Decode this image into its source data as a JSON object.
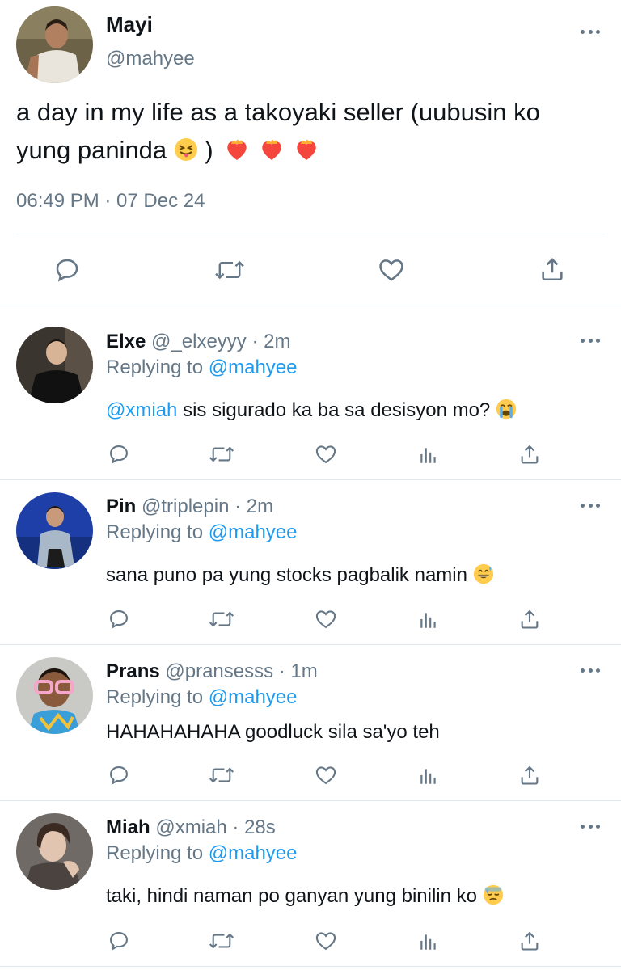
{
  "tweet": {
    "name": "Mayi",
    "handle": "@mahyee",
    "text_line1": "a day in my life as a takoyaki seller (uubusin ko",
    "text_line2_pre": "yung paninda",
    "text_line2_post": ")",
    "timestamp": "06:49 PM · 07 Dec 24"
  },
  "replies": [
    {
      "name": "Elxe",
      "handle": "@_elxeyyy",
      "time": "· 2m",
      "replying_label": "Replying to",
      "replying_to": "@mahyee",
      "mention": "@xmiah",
      "text": "sis sigurado ka ba sa desisyon mo?"
    },
    {
      "name": "Pin",
      "handle": "@triplepin",
      "time": "· 2m",
      "replying_label": "Replying to",
      "replying_to": "@mahyee",
      "text": "sana puno pa yung stocks pagbalik namin"
    },
    {
      "name": "Prans",
      "handle": "@pransesss",
      "time": "· 1m",
      "replying_label": "Replying to",
      "replying_to": "@mahyee",
      "text": "HAHAHAHAHA goodluck sila sa'yo teh"
    },
    {
      "name": "Miah",
      "handle": "@xmiah",
      "time": "· 28s",
      "replying_label": "Replying to",
      "replying_to": "@mahyee",
      "text": "taki, hindi naman po ganyan yung binilin ko"
    }
  ],
  "colors": {
    "link": "#1d9bf0",
    "muted": "#657786",
    "text": "#0f1419",
    "divider": "#e1e8ed"
  },
  "icons": [
    "reply-icon",
    "retweet-icon",
    "like-icon",
    "share-icon",
    "views-icon",
    "more-icon"
  ]
}
